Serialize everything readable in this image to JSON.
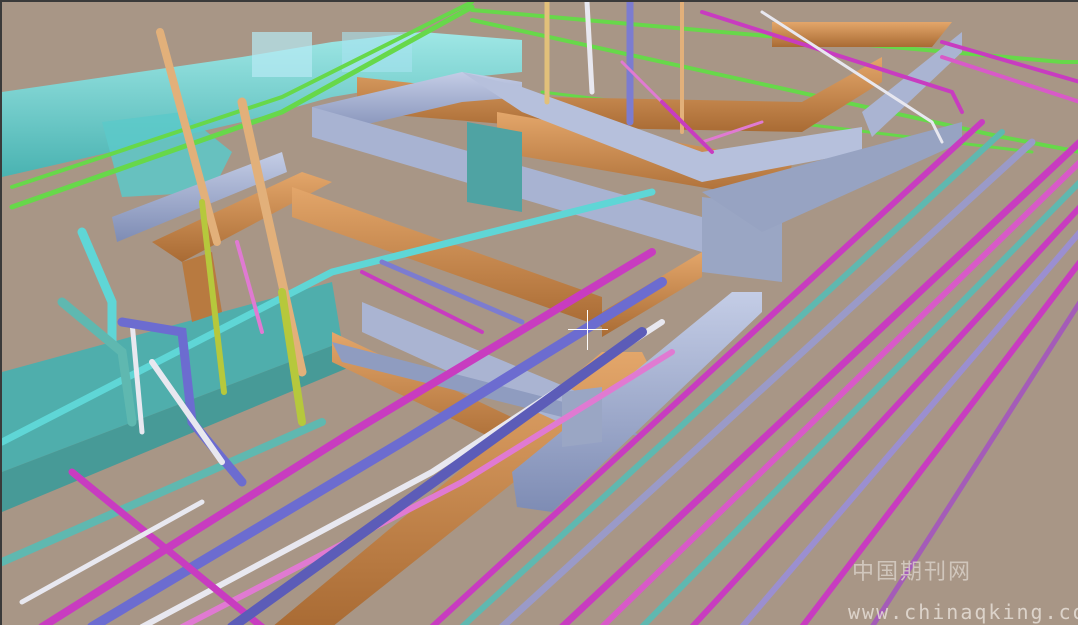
{
  "viewport": {
    "background": "#a89686",
    "cursor": "crosshair"
  },
  "colors": {
    "duct_cyan": "#6fd3d3",
    "duct_blue_gray": "#9aa8c8",
    "duct_orange": "#c98a4e",
    "pipe_magenta": "#c83cc0",
    "pipe_pink": "#e07ad2",
    "pipe_green": "#67d84a",
    "pipe_teal": "#5fb8b0",
    "pipe_white": "#e8e8f0",
    "pipe_blue": "#6c6cd0",
    "pipe_tan": "#e2b07a",
    "pipe_yellow_green": "#b6c83c"
  },
  "watermark": {
    "chinese": "中国期刊网",
    "url": "www.chinaqking.com"
  }
}
